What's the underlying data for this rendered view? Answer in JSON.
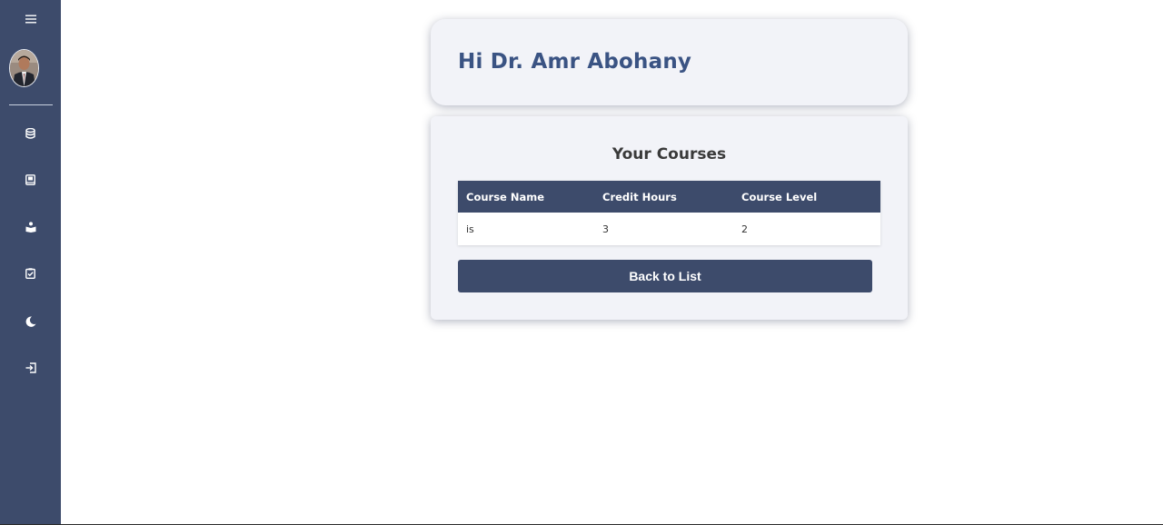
{
  "sidebar": {
    "items": [
      {
        "icon": "menu-icon"
      },
      {
        "icon": "avatar"
      },
      {
        "icon": "database-icon"
      },
      {
        "icon": "book-icon"
      },
      {
        "icon": "reader-icon"
      },
      {
        "icon": "clipboard-check-icon"
      },
      {
        "icon": "moon-icon"
      },
      {
        "icon": "logout-icon"
      }
    ]
  },
  "greeting": {
    "text": "Hi Dr. Amr Abohany"
  },
  "courses": {
    "title": "Your Courses",
    "columns": [
      "Course Name",
      "Credit Hours",
      "Course Level"
    ],
    "rows": [
      [
        "is",
        "3",
        "2"
      ]
    ],
    "back_label": "Back to List"
  },
  "colors": {
    "sidebar_bg": "#3d4b6b",
    "card_bg": "#f2f3f8",
    "greeting_text": "#3a5383",
    "table_header_bg": "#3d4b6b",
    "button_bg": "#3d4b6b"
  }
}
